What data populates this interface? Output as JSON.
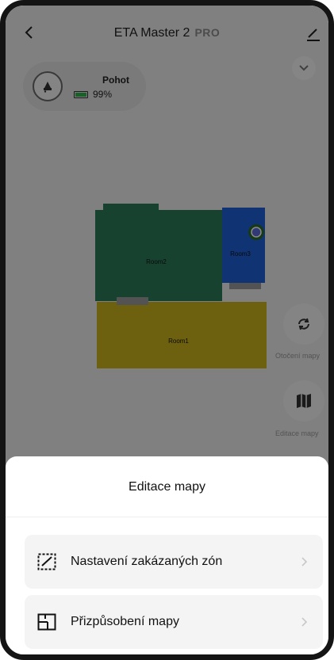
{
  "header": {
    "title": "ETA Master 2",
    "badge": "PRO",
    "back_icon": "chevron-left-icon",
    "edit_icon": "pencil-icon"
  },
  "collapse_icon": "chevron-down-icon",
  "status": {
    "mode": "Pohot",
    "battery_percent_text": "99%",
    "battery_level": 0.99,
    "battery_color": "#2fb34a"
  },
  "map": {
    "rooms": [
      {
        "label": "Room2",
        "color": "#2d7a5a"
      },
      {
        "label": "Room3",
        "color": "#1f5fd6"
      },
      {
        "label": "Room1",
        "color": "#c9b21a"
      }
    ]
  },
  "side_buttons": [
    {
      "label": "Otočení mapy",
      "icon": "rotate-icon"
    },
    {
      "label": "Editace mapy",
      "icon": "map-icon"
    }
  ],
  "sheet": {
    "title": "Editace mapy",
    "items": [
      {
        "label": "Nastavení zakázaných zón",
        "icon": "restricted-zone-icon"
      },
      {
        "label": "Přizpůsobení mapy",
        "icon": "floorplan-icon"
      }
    ]
  },
  "colors": {
    "overlay": "rgba(0,0,0,0.46)",
    "sheet_bg": "#ffffff",
    "item_bg": "#f4f4f4"
  }
}
